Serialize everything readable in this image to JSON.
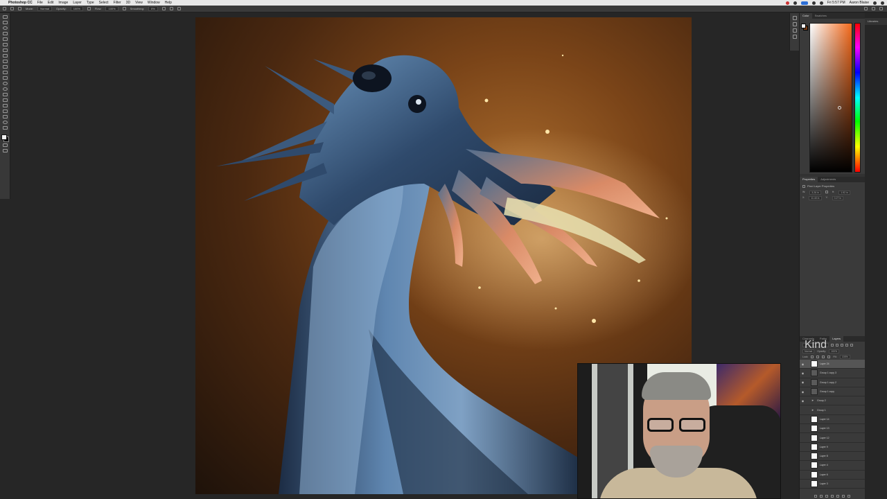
{
  "menubar": {
    "items": [
      "Photoshop CC",
      "File",
      "Edit",
      "Image",
      "Layer",
      "Type",
      "Select",
      "Filter",
      "3D",
      "View",
      "Window",
      "Help"
    ],
    "time": "Fri 5:57 PM",
    "user": "Aaron Blaise"
  },
  "options": {
    "mode_label": "Mode:",
    "mode_value": "Normal",
    "opacity_label": "Opacity:",
    "opacity_value": "100%",
    "flow_label": "Flow:",
    "flow_value": "100%",
    "smoothing_label": "Smoothing:",
    "smoothing_value": "0%"
  },
  "color_panel": {
    "tabs": [
      "Color",
      "Swatches"
    ]
  },
  "libraries_label": "Libraries",
  "properties_panel": {
    "tabs": [
      "Properties",
      "Adjustments"
    ],
    "subtitle": "Pixel Layer Properties",
    "w_label": "W:",
    "w_value": "3.26 in",
    "h_label": "H:",
    "h_value": "1.92 in",
    "x_label": "X:",
    "x_value": "11.40 in",
    "y_label": "Y:",
    "y_value": "0.27 in"
  },
  "layers_panel": {
    "tabs": [
      "Channels",
      "Paths",
      "Layers"
    ],
    "kind_label": "Kind",
    "blend_value": "Normal",
    "opacity_label": "Opacity:",
    "opacity_value": "100%",
    "lock_label": "Lock:",
    "fill_label": "Fill:",
    "fill_value": "100%",
    "layers": [
      {
        "name": "Layer 24",
        "type": "pixel",
        "visible": true,
        "selected": true
      },
      {
        "name": "Group 1 copy 3",
        "type": "art",
        "visible": true,
        "selected": false
      },
      {
        "name": "Group 1 copy 2",
        "type": "art",
        "visible": true,
        "selected": false
      },
      {
        "name": "Group 1 copy",
        "type": "art",
        "visible": true,
        "selected": false
      },
      {
        "name": "Group 2",
        "type": "group",
        "visible": true,
        "selected": false
      },
      {
        "name": "Group 1",
        "type": "group",
        "visible": false,
        "selected": false
      },
      {
        "name": "Layer 14",
        "type": "pixel",
        "visible": false,
        "selected": false
      },
      {
        "name": "Layer 13",
        "type": "pixel",
        "visible": false,
        "selected": false
      },
      {
        "name": "Layer 12",
        "type": "pixel",
        "visible": false,
        "selected": false
      },
      {
        "name": "Layer 9",
        "type": "pixel",
        "visible": false,
        "selected": false
      },
      {
        "name": "Layer 8",
        "type": "pixel",
        "visible": false,
        "selected": false
      },
      {
        "name": "Layer 4",
        "type": "pixel",
        "visible": false,
        "selected": false
      },
      {
        "name": "Layer 6",
        "type": "pixel",
        "visible": false,
        "selected": false
      },
      {
        "name": "Layer 3",
        "type": "pixel",
        "visible": false,
        "selected": false
      }
    ]
  },
  "colors": {
    "foreground": "#f3f3f3",
    "background": "#000000",
    "picked_hue": "#f46a1c"
  }
}
